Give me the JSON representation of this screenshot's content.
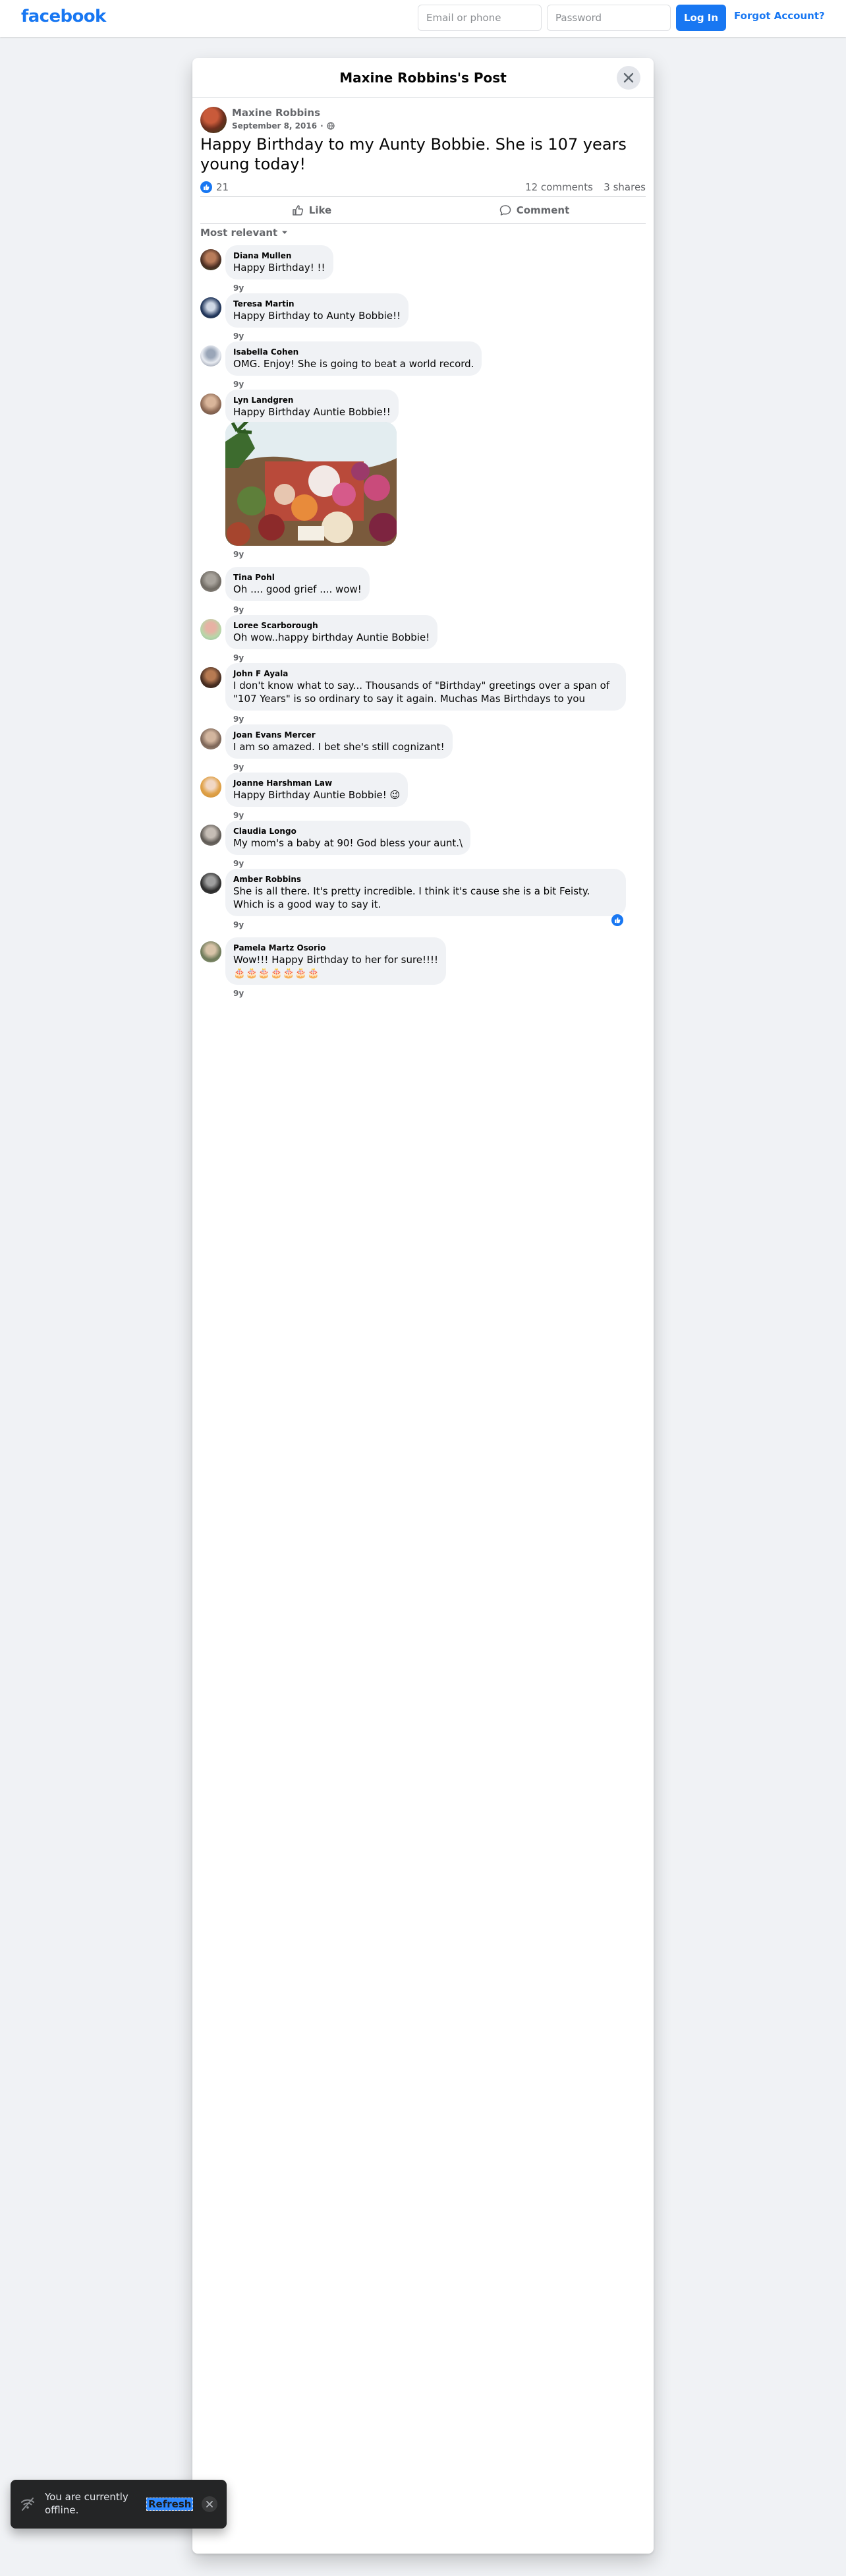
{
  "header": {
    "logo": "facebook",
    "email_placeholder": "Email or phone",
    "password_placeholder": "Password",
    "login_label": "Log In",
    "forgot_label": "Forgot Account?"
  },
  "dialog": {
    "title": "Maxine Robbins's Post"
  },
  "post": {
    "author": "Maxine Robbins",
    "date": "September 8, 2016",
    "separator": "·",
    "text": "Happy Birthday to my Aunty Bobbie. She is 107 years young today!",
    "reaction_count": "21",
    "comments_label": "12 comments",
    "shares_label": "3 shares"
  },
  "actions": {
    "like_label": "Like",
    "comment_label": "Comment"
  },
  "sort_label": "Most relevant",
  "comments": [
    {
      "author": "Diana Mullen",
      "text": "Happy Birthday! !!",
      "time": "9y"
    },
    {
      "author": "Teresa Martin",
      "text": "Happy Birthday to Aunty Bobbie!!",
      "time": "9y"
    },
    {
      "author": "Isabella Cohen",
      "text": "OMG. Enjoy! She is going to beat a world record.",
      "time": "9y"
    },
    {
      "author": "Lyn Landgren",
      "text": "Happy Birthday Auntie Bobbie!!",
      "time": "9y"
    },
    {
      "author": "Tina Pohl",
      "text": "Oh .... good grief .... wow!",
      "time": "9y"
    },
    {
      "author": "Loree Scarborough",
      "text": "Oh wow..happy birthday Auntie Bobbie!",
      "time": "9y"
    },
    {
      "author": "John F Ayala",
      "text": "I don't know what to say... Thousands of \"Birthday\" greetings over a span of \"107 Years\" is so ordinary to say it again. Muchas Mas Birthdays to you",
      "time": "9y"
    },
    {
      "author": "Joan Evans Mercer",
      "text": "I am so amazed. I bet she's still cognizant!",
      "time": "9y"
    },
    {
      "author": "Joanne Harshman Law",
      "text": "Happy Birthday Auntie Bobbie! 😉",
      "time": "9y"
    },
    {
      "author": "Claudia Longo",
      "text": "My mom's a baby at 90! God bless your aunt.\\",
      "time": "9y"
    },
    {
      "author": "Amber Robbins",
      "text": "She is all there. It's pretty incredible. I think it's cause she is a bit Feisty. Which is a good way to say it.",
      "time": "9y"
    },
    {
      "author": "Pamela Martz Osorio",
      "text": "Wow!!! Happy Birthday to her for sure!!!!",
      "text2": "🎂🎂🎂🎂🎂🎂🎂",
      "time": "9y"
    }
  ],
  "toast": {
    "message": "You are currently offline.",
    "refresh_label": "Refresh"
  },
  "colors": {
    "brand_blue": "#1877f2",
    "page_bg": "#f0f2f5",
    "secondary_text": "#65676b"
  }
}
